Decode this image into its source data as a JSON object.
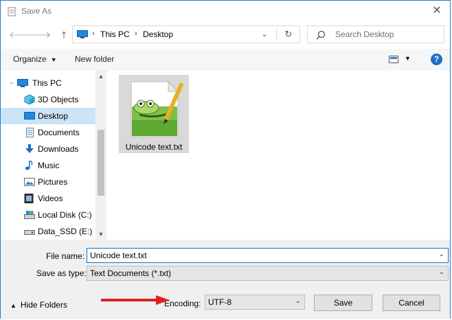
{
  "window": {
    "title": "Save As"
  },
  "nav": {
    "breadcrumb": [
      "This PC",
      "Desktop"
    ],
    "search_placeholder": "Search Desktop"
  },
  "toolbar": {
    "organize_label": "Organize",
    "new_folder_label": "New folder",
    "help_label": "?"
  },
  "sidebar": {
    "items": [
      {
        "label": "This PC",
        "icon": "pc-icon",
        "selected": false
      },
      {
        "label": "3D Objects",
        "icon": "cube-icon",
        "selected": false
      },
      {
        "label": "Desktop",
        "icon": "desktop-icon",
        "selected": true
      },
      {
        "label": "Documents",
        "icon": "documents-icon",
        "selected": false
      },
      {
        "label": "Downloads",
        "icon": "download-arrow-icon",
        "selected": false
      },
      {
        "label": "Music",
        "icon": "music-note-icon",
        "selected": false
      },
      {
        "label": "Pictures",
        "icon": "pictures-icon",
        "selected": false
      },
      {
        "label": "Videos",
        "icon": "videos-icon",
        "selected": false
      },
      {
        "label": "Local Disk (C:)",
        "icon": "disk-icon",
        "selected": false
      },
      {
        "label": "Data_SSD (E:)",
        "icon": "drive-icon",
        "selected": false
      }
    ]
  },
  "files": [
    {
      "name": "Unicode text.txt",
      "icon": "notepadpp-file-icon",
      "selected": true
    }
  ],
  "form": {
    "file_name_label": "File name:",
    "file_name_value": "Unicode text.txt",
    "save_type_label": "Save as type:",
    "save_type_value": "Text Documents (*.txt)",
    "encoding_label": "Encoding:",
    "encoding_value": "UTF-8",
    "hide_folders_label": "Hide Folders",
    "save_label": "Save",
    "cancel_label": "Cancel"
  },
  "colors": {
    "accent": "#0078d7",
    "selection": "#cce4f7",
    "annotation_arrow": "#e02020"
  }
}
